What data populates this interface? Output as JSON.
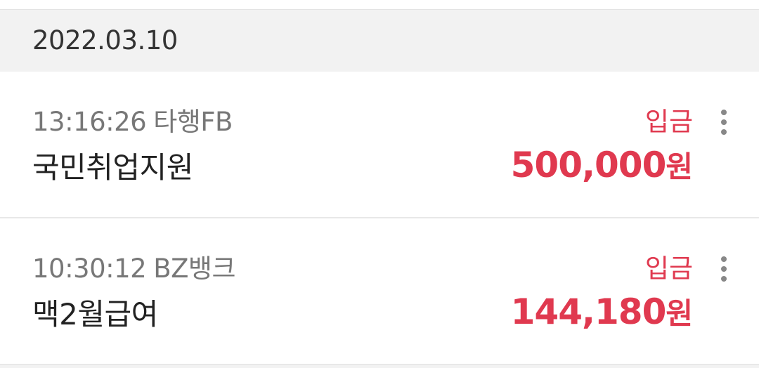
{
  "date_header": {
    "date": "2022.03.10"
  },
  "transactions": [
    {
      "time": "13:16:26",
      "counterparty": "타행FB",
      "description": "국민취업지원",
      "type": "입금",
      "amount": "500,000",
      "currency_unit": "원"
    },
    {
      "time": "10:30:12",
      "counterparty": "BZ뱅크",
      "description": "맥2월급여",
      "type": "입금",
      "amount": "144,180",
      "currency_unit": "원"
    }
  ],
  "icons": {
    "more": "more-vertical-icon"
  },
  "colors": {
    "deposit_accent": "#e0394f",
    "header_bg": "#f2f2f2",
    "meta_text": "#777777",
    "primary_text": "#222222"
  }
}
